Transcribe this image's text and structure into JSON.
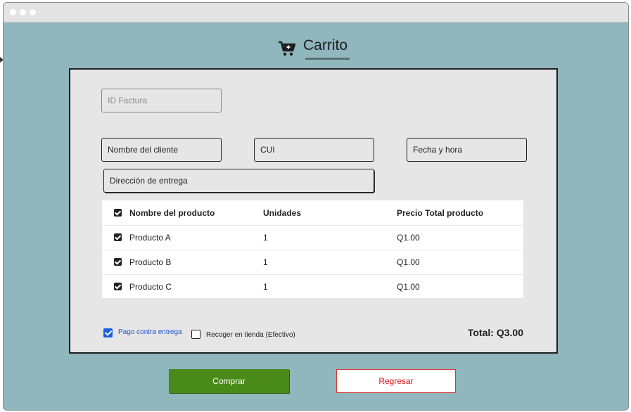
{
  "header": {
    "title": "Carrito",
    "icon": "cart-add-icon"
  },
  "form": {
    "invoice_id_placeholder": "ID Factura",
    "client_name_placeholder": "Nombre del cliente",
    "cui_placeholder": "CUI",
    "datetime_placeholder": "Fecha y hora",
    "address_placeholder": "Dirección de entrega"
  },
  "table": {
    "headers": [
      "Nombre del producto",
      "Unidades",
      "Precio Total producto"
    ],
    "rows": [
      {
        "product": "Producto A",
        "units": "1",
        "price": "Q1.00",
        "checked": true
      },
      {
        "product": "Producto B",
        "units": "1",
        "price": "Q1.00",
        "checked": true
      },
      {
        "product": "Producto C",
        "units": "1",
        "price": "Q1.00",
        "checked": true
      }
    ]
  },
  "payment": {
    "cash_on_delivery_label": "Pago contra entrega",
    "cash_on_delivery_checked": true,
    "store_pickup_label": "Recoger en tienda (Efectivo)",
    "store_pickup_checked": false
  },
  "total_label": "Total: Q3.00",
  "actions": {
    "buy_label": "Comprar",
    "back_label": "Regresar"
  },
  "colors": {
    "background": "#90b6be",
    "buy": "#4a8a19",
    "back_text": "#d11111",
    "checkbox_blue": "#1d5fe0"
  }
}
